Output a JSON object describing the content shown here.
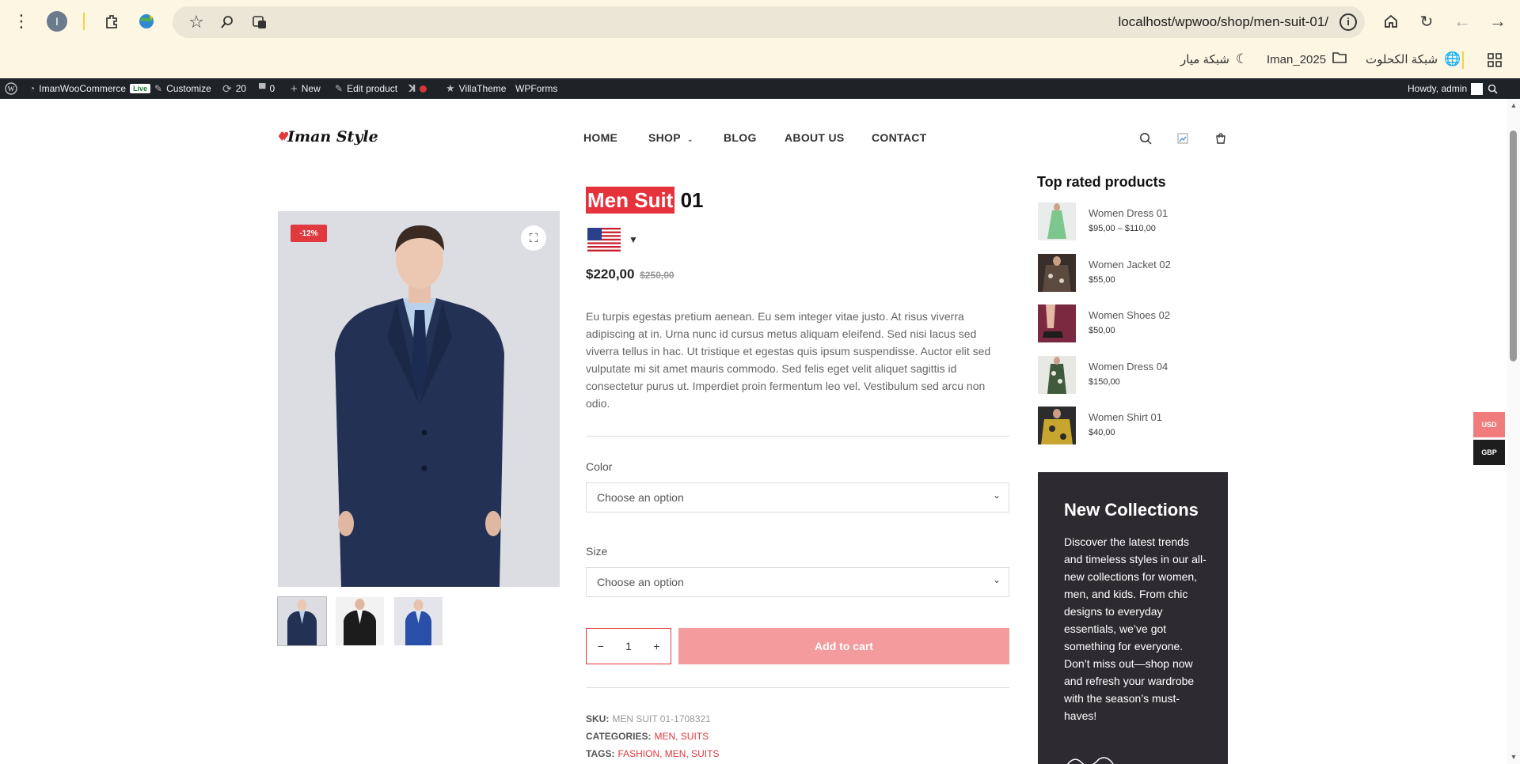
{
  "browser": {
    "url": "localhost/wpwoo/shop/men-suit-01/",
    "profile_initial": "I",
    "bookmarks": [
      {
        "label": "شبكة الكحلوت"
      },
      {
        "label": "Iman_2025"
      },
      {
        "label": "شبكة ميار"
      }
    ]
  },
  "adminbar": {
    "site": "ImanWooCommerce",
    "live": "Live",
    "customize": "Customize",
    "updates": "20",
    "comments": "0",
    "new": "New",
    "edit": "Edit product",
    "villatheme": "VillaTheme",
    "wpforms": "WPForms",
    "howdy": "Howdy, admin"
  },
  "header": {
    "logo_text": "Iman Style",
    "nav": [
      {
        "label": "HOME"
      },
      {
        "label": "SHOP"
      },
      {
        "label": "BLOG"
      },
      {
        "label": "ABOUT US"
      },
      {
        "label": "CONTACT"
      }
    ]
  },
  "product": {
    "title_highlight": "Men Suit",
    "title_rest": " 01",
    "sale_badge": "-12%",
    "price": "$220,00",
    "old_price": "$250,00",
    "description": "Eu turpis egestas pretium aenean. Eu sem integer vitae justo. At risus viverra adipiscing at in. Urna nunc id cursus metus aliquam eleifend. Sed nisi lacus sed viverra tellus in hac. Ut tristique et egestas quis ipsum suspendisse. Auctor elit sed vulputate mi sit amet mauris commodo. Sed felis eget velit aliquet sagittis id consectetur purus ut. Imperdiet proin fermentum leo vel. Vestibulum sed arcu non odio.",
    "color_label": "Color",
    "color_placeholder": "Choose an option",
    "size_label": "Size",
    "size_placeholder": "Choose an option",
    "qty": "1",
    "qty_minus": "−",
    "qty_plus": "+",
    "add_to_cart": "Add to cart",
    "sku_label": "SKU:",
    "sku": "MEN SUIT 01-1708321",
    "categories_label": "CATEGORIES:",
    "categories": "MEN, SUITS",
    "tags_label": "TAGS:",
    "tags": "FASHION, MEN, SUITS"
  },
  "sidebar": {
    "title": "Top rated products",
    "items": [
      {
        "name": "Women Dress 01",
        "price": "$95,00 – $110,00",
        "color": "#7dc78e"
      },
      {
        "name": "Women Jacket 02",
        "price": "$55,00",
        "color": "#3a2e2a"
      },
      {
        "name": "Women Shoes 02",
        "price": "$50,00",
        "color": "#7a2940"
      },
      {
        "name": "Women Dress 04",
        "price": "$150,00",
        "color": "#3f5a3c"
      },
      {
        "name": "Women Shirt 01",
        "price": "$40,00",
        "color": "#c7a52e"
      }
    ],
    "promo_title": "New Collections",
    "promo_text": "Discover the latest trends and timeless styles in our all-new collections for women, men, and kids. From chic designs to everyday essentials, we’ve got something for everyone. Don’t miss out—shop now and refresh your wardrobe with the season’s must-haves!"
  },
  "currency": {
    "usd": "USD",
    "gbp": "GBP",
    "usd_color": "#f07c7e",
    "gbp_color": "#1d1d1d"
  },
  "colors": {
    "accent": "#e0393e",
    "add_to_cart_bg": "#f39b9d",
    "promo_bg": "#2d2b2f"
  }
}
